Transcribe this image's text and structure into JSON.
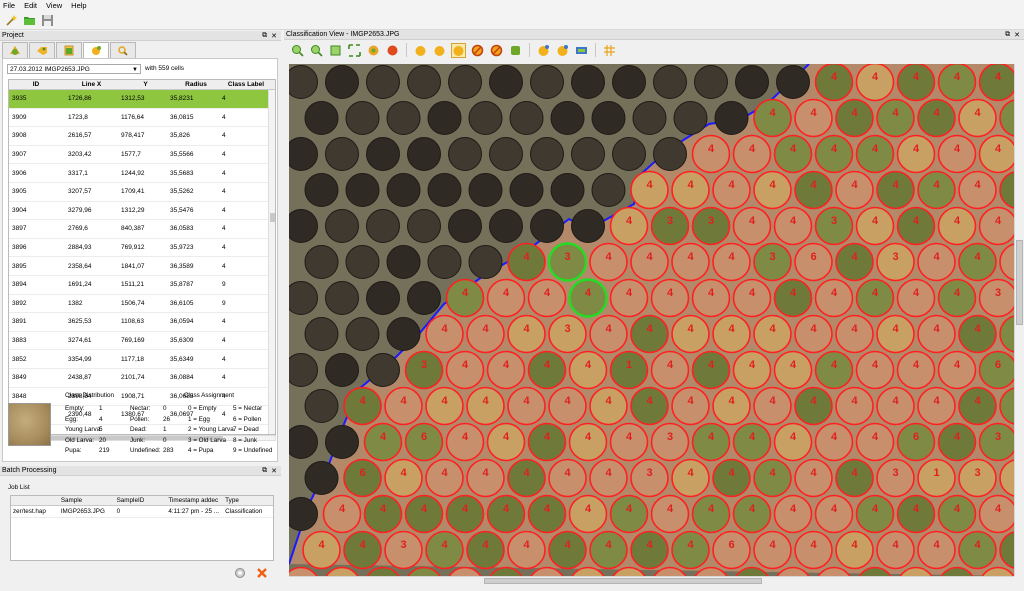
{
  "menu": [
    "File",
    "Edit",
    "View",
    "Help"
  ],
  "project_dock": {
    "title": "Project"
  },
  "batch_dock": {
    "title": "Batch Processing"
  },
  "image_select": {
    "value": "27.03.2012     IMGP2653.JPG",
    "count_text": "with 559 cells"
  },
  "table": {
    "columns": [
      "ID",
      "Line X",
      "Y",
      "Radius",
      "Class Label"
    ],
    "rows": [
      [
        "3935",
        "1726,86",
        "1312,53",
        "35,8231",
        "4"
      ],
      [
        "3909",
        "1723,8",
        "1176,64",
        "36,0815",
        "4"
      ],
      [
        "3908",
        "2616,57",
        "978,417",
        "35,826",
        "4"
      ],
      [
        "3907",
        "3203,42",
        "1577,7",
        "35,5566",
        "4"
      ],
      [
        "3906",
        "3317,1",
        "1244,92",
        "35,5683",
        "4"
      ],
      [
        "3905",
        "3207,57",
        "1709,41",
        "35,5262",
        "4"
      ],
      [
        "3904",
        "3279,96",
        "1312,29",
        "35,5476",
        "4"
      ],
      [
        "3897",
        "2769,6",
        "840,387",
        "36,0583",
        "4"
      ],
      [
        "3896",
        "2884,93",
        "769,912",
        "35,9723",
        "4"
      ],
      [
        "3895",
        "2358,64",
        "1841,07",
        "36,3589",
        "4"
      ],
      [
        "3894",
        "1691,24",
        "1511,21",
        "35,8787",
        "9"
      ],
      [
        "3892",
        "1382",
        "1506,74",
        "36,6105",
        "9"
      ],
      [
        "3891",
        "3625,53",
        "1108,63",
        "36,0594",
        "4"
      ],
      [
        "3883",
        "3274,61",
        "769,169",
        "35,6309",
        "4"
      ],
      [
        "3852",
        "3354,99",
        "1177,18",
        "35,6349",
        "4"
      ],
      [
        "3849",
        "2438,87",
        "2101,74",
        "36,0884",
        "4"
      ],
      [
        "3848",
        "2398,54",
        "1908,71",
        "36,0685",
        "4"
      ],
      [
        "3846",
        "2390,48",
        "1380,67",
        "36,0697",
        "4"
      ]
    ]
  },
  "class_distribution": {
    "title": "Class Distribution",
    "items": [
      [
        "Empty:",
        "1",
        "Nectar:",
        "0"
      ],
      [
        "Egg:",
        "4",
        "Pollen:",
        "26"
      ],
      [
        "Young Larva:",
        "5",
        "Dead:",
        "1"
      ],
      [
        "Old Larva:",
        "20",
        "Junk:",
        "0"
      ],
      [
        "Pupa:",
        "219",
        "Undefined:",
        "283"
      ]
    ]
  },
  "class_assignment": {
    "title": "Class Assignment",
    "items": [
      [
        "0 = Empty",
        "5 = Nectar"
      ],
      [
        "1 = Egg",
        "6 = Pollen"
      ],
      [
        "2 = Young Larva",
        "7 = Dead"
      ],
      [
        "3 = Old Larva",
        "8 = Junk"
      ],
      [
        "4 = Pupa",
        "9 = Undefined"
      ]
    ]
  },
  "job_list": {
    "title": "Job List",
    "columns": [
      "",
      "Sample",
      "SampleID",
      "Timestamp addec",
      "Type"
    ],
    "rows": [
      [
        "zer/test.hap",
        "IMGP2653.JPG",
        "0",
        "4:11:27 pm - 25 ...",
        "Classification"
      ]
    ]
  },
  "view": {
    "title": "Classification View - IMGP2653.JPG"
  },
  "colors": {
    "selected_row": "#8ec63f",
    "cell_ring": "#ff2020",
    "highlight_ring": "#22dd22",
    "boundary": "#1a1aff",
    "label": "#e02020"
  }
}
